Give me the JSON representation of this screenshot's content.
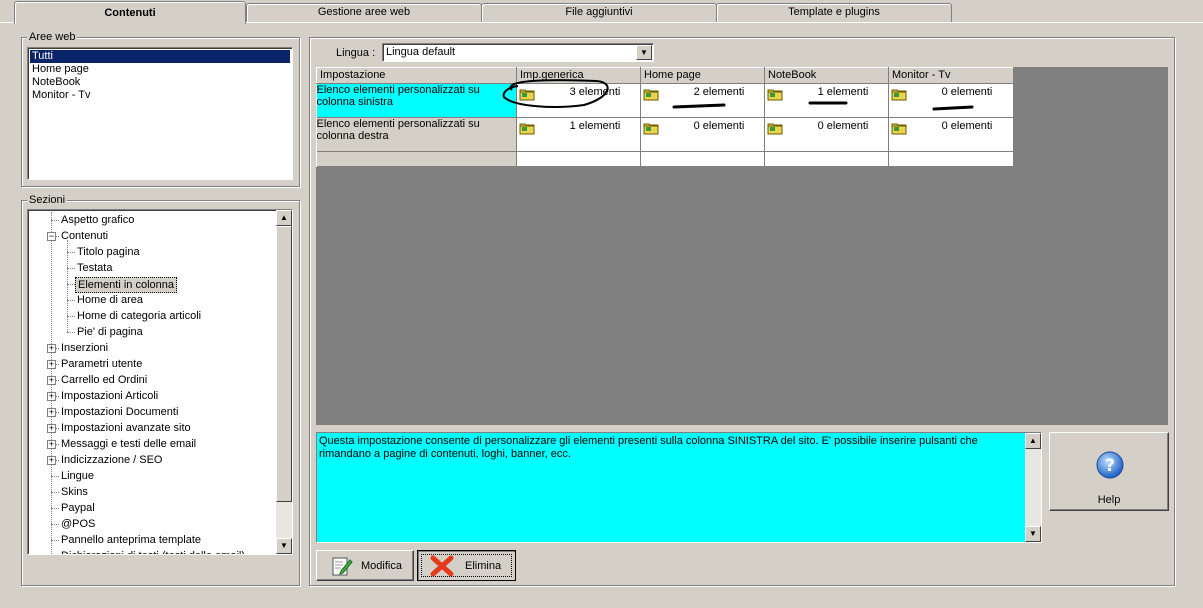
{
  "tabs": [
    {
      "label": "Contenuti",
      "active": true
    },
    {
      "label": "Gestione aree web",
      "active": false
    },
    {
      "label": "File aggiuntivi",
      "active": false
    },
    {
      "label": "Template e plugins",
      "active": false
    }
  ],
  "aree_web": {
    "legend": "Aree web",
    "items": [
      "Tutti",
      "Home page",
      "NoteBook",
      "Monitor - Tv"
    ],
    "selected": "Tutti"
  },
  "sezioni": {
    "legend": "Sezioni",
    "items": [
      {
        "label": "Aspetto grafico",
        "level": 0,
        "expander": ""
      },
      {
        "label": "Contenuti",
        "level": 0,
        "expander": "−"
      },
      {
        "label": "Titolo pagina",
        "level": 1,
        "expander": ""
      },
      {
        "label": "Testata",
        "level": 1,
        "expander": ""
      },
      {
        "label": "Elementi in colonna",
        "level": 1,
        "expander": "",
        "selected": true
      },
      {
        "label": "Home di area",
        "level": 1,
        "expander": ""
      },
      {
        "label": "Home di categoria articoli",
        "level": 1,
        "expander": ""
      },
      {
        "label": "Pie' di pagina",
        "level": 1,
        "expander": ""
      },
      {
        "label": "Inserzioni",
        "level": 0,
        "expander": "+"
      },
      {
        "label": "Parametri utente",
        "level": 0,
        "expander": "+"
      },
      {
        "label": "Carrello ed Ordini",
        "level": 0,
        "expander": "+"
      },
      {
        "label": "Impostazioni Articoli",
        "level": 0,
        "expander": "+"
      },
      {
        "label": "Impostazioni Documenti",
        "level": 0,
        "expander": "+"
      },
      {
        "label": "Impostazioni avanzate sito",
        "level": 0,
        "expander": "+"
      },
      {
        "label": "Messaggi e testi delle email",
        "level": 0,
        "expander": "+"
      },
      {
        "label": "Indicizzazione / SEO",
        "level": 0,
        "expander": "+"
      },
      {
        "label": "Lingue",
        "level": 0,
        "expander": ""
      },
      {
        "label": "Skins",
        "level": 0,
        "expander": ""
      },
      {
        "label": "Paypal",
        "level": 0,
        "expander": ""
      },
      {
        "label": "@POS",
        "level": 0,
        "expander": ""
      },
      {
        "label": "Pannello anteprima template",
        "level": 0,
        "expander": ""
      },
      {
        "label": "Dichiarazioni di testi (testi delle email)",
        "level": 0,
        "expander": ""
      }
    ]
  },
  "lingua": {
    "label": "Lingua :",
    "value": "Lingua default"
  },
  "grid": {
    "columns": [
      "Impostazione",
      "Imp.generica",
      "Home page",
      "NoteBook",
      "Monitor - Tv"
    ],
    "rows": [
      {
        "label": "Elenco elementi personalizzati su colonna sinistra",
        "current": true,
        "values": [
          "3 elementi",
          "2 elementi",
          "1 elementi",
          "0 elementi"
        ]
      },
      {
        "label": "Elenco elementi personalizzati su colonna destra",
        "current": false,
        "values": [
          "1 elementi",
          "0 elementi",
          "0 elementi",
          "0 elementi"
        ]
      }
    ]
  },
  "description": "Questa impostazione consente di personalizzare gli elementi presenti sulla colonna SINISTRA del sito. E' possibile inserire pulsanti che rimandano a pagine di contenuti, loghi, banner, ecc.",
  "buttons": {
    "help": "Help",
    "modifica": "Modifica",
    "elimina": "Elimina"
  },
  "colors": {
    "selection": "#0a246a",
    "highlight_cell": "#00ffff",
    "face": "#d4d0c8"
  },
  "icons": [
    "folder-icon",
    "help-icon",
    "edit-icon",
    "delete-icon"
  ]
}
